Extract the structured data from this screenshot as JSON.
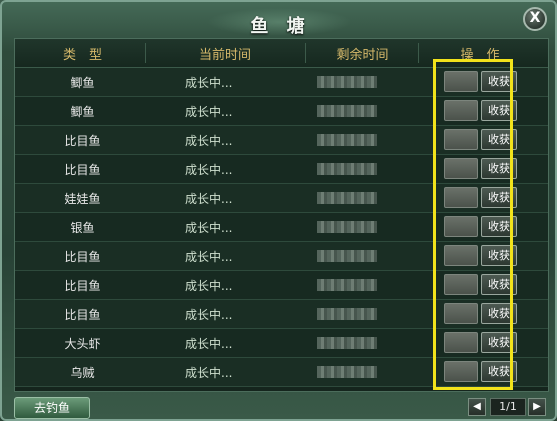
{
  "window": {
    "title": "鱼 塘",
    "close_label": "X"
  },
  "table": {
    "headers": [
      "类　型",
      "当前时间",
      "剩余时间",
      "操　作"
    ],
    "rows": [
      {
        "type": "鲫鱼",
        "current": "成长中...",
        "action": "收获"
      },
      {
        "type": "鲫鱼",
        "current": "成长中...",
        "action": "收获"
      },
      {
        "type": "比目鱼",
        "current": "成长中...",
        "action": "收获"
      },
      {
        "type": "比目鱼",
        "current": "成长中...",
        "action": "收获"
      },
      {
        "type": "娃娃鱼",
        "current": "成长中...",
        "action": "收获"
      },
      {
        "type": "银鱼",
        "current": "成长中...",
        "action": "收获"
      },
      {
        "type": "比目鱼",
        "current": "成长中...",
        "action": "收获"
      },
      {
        "type": "比目鱼",
        "current": "成长中...",
        "action": "收获"
      },
      {
        "type": "比目鱼",
        "current": "成长中...",
        "action": "收获"
      },
      {
        "type": "大头虾",
        "current": "成长中...",
        "action": "收获"
      },
      {
        "type": "乌贼",
        "current": "成长中...",
        "action": "收获"
      }
    ]
  },
  "footer": {
    "go_fish_label": "去钓鱼",
    "page_info": "1/1",
    "prev_icon": "◀",
    "next_icon": "▶"
  },
  "colors": {
    "header_text": "#d5b86a",
    "highlight": "#f2e31b"
  }
}
